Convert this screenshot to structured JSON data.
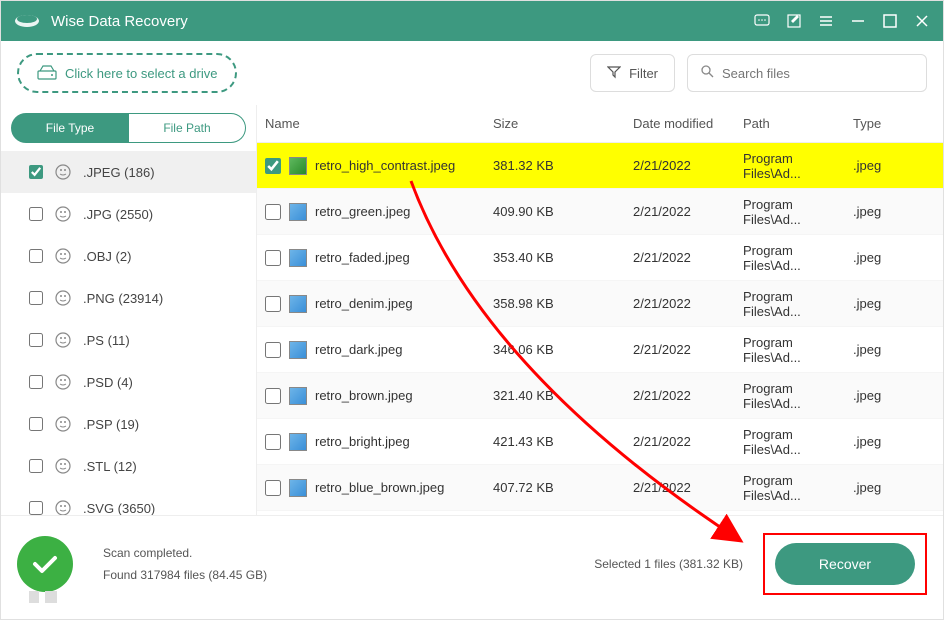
{
  "app": {
    "title": "Wise Data Recovery"
  },
  "toolbar": {
    "drive_select_label": "Click here to select a drive",
    "filter_label": "Filter",
    "search_placeholder": "Search files"
  },
  "sidebar": {
    "tabs": {
      "file_type": "File Type",
      "file_path": "File Path"
    },
    "types": [
      {
        "label": ".JPEG (186)",
        "checked": true,
        "selected": true
      },
      {
        "label": ".JPG (2550)",
        "checked": false
      },
      {
        "label": ".OBJ (2)",
        "checked": false
      },
      {
        "label": ".PNG (23914)",
        "checked": false
      },
      {
        "label": ".PS (11)",
        "checked": false
      },
      {
        "label": ".PSD (4)",
        "checked": false
      },
      {
        "label": ".PSP (19)",
        "checked": false
      },
      {
        "label": ".STL (12)",
        "checked": false
      },
      {
        "label": ".SVG (3650)",
        "checked": false
      }
    ]
  },
  "table": {
    "headers": {
      "name": "Name",
      "size": "Size",
      "date": "Date modified",
      "path": "Path",
      "type": "Type"
    },
    "rows": [
      {
        "name": "retro_high_contrast.jpeg",
        "size": "381.32 KB",
        "date": "2/21/2022",
        "path": "Program Files\\Ad...",
        "type": ".jpeg",
        "checked": true,
        "highlighted": true
      },
      {
        "name": "retro_green.jpeg",
        "size": "409.90 KB",
        "date": "2/21/2022",
        "path": "Program Files\\Ad...",
        "type": ".jpeg",
        "checked": false
      },
      {
        "name": "retro_faded.jpeg",
        "size": "353.40 KB",
        "date": "2/21/2022",
        "path": "Program Files\\Ad...",
        "type": ".jpeg",
        "checked": false
      },
      {
        "name": "retro_denim.jpeg",
        "size": "358.98 KB",
        "date": "2/21/2022",
        "path": "Program Files\\Ad...",
        "type": ".jpeg",
        "checked": false
      },
      {
        "name": "retro_dark.jpeg",
        "size": "346.06 KB",
        "date": "2/21/2022",
        "path": "Program Files\\Ad...",
        "type": ".jpeg",
        "checked": false
      },
      {
        "name": "retro_brown.jpeg",
        "size": "321.40 KB",
        "date": "2/21/2022",
        "path": "Program Files\\Ad...",
        "type": ".jpeg",
        "checked": false
      },
      {
        "name": "retro_bright.jpeg",
        "size": "421.43 KB",
        "date": "2/21/2022",
        "path": "Program Files\\Ad...",
        "type": ".jpeg",
        "checked": false
      },
      {
        "name": "retro_blue_brown.jpeg",
        "size": "407.72 KB",
        "date": "2/21/2022",
        "path": "Program Files\\Ad...",
        "type": ".jpeg",
        "checked": false
      }
    ]
  },
  "footer": {
    "status_line1": "Scan completed.",
    "status_line2": "Found 317984 files (84.45 GB)",
    "selected_text": "Selected 1 files (381.32 KB)",
    "recover_label": "Recover"
  }
}
